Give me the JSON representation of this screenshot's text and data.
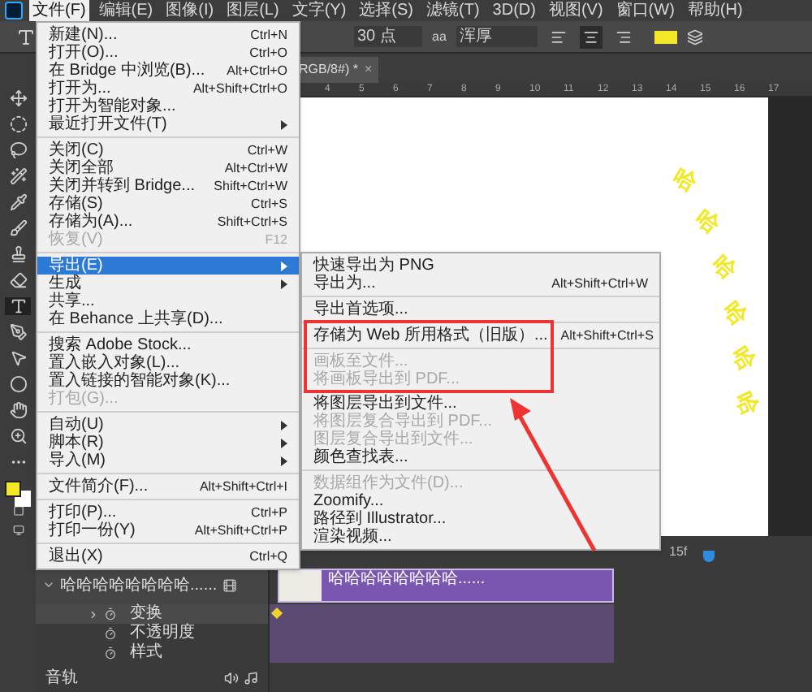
{
  "menubar": {
    "items": [
      {
        "label": "文件(F)",
        "selected": true
      },
      {
        "label": "编辑(E)",
        "selected": false
      },
      {
        "label": "图像(I)",
        "selected": false
      },
      {
        "label": "图层(L)",
        "selected": false
      },
      {
        "label": "文字(Y)",
        "selected": false
      },
      {
        "label": "选择(S)",
        "selected": false
      },
      {
        "label": "滤镜(T)",
        "selected": false
      },
      {
        "label": "3D(D)",
        "selected": false
      },
      {
        "label": "视图(V)",
        "selected": false
      },
      {
        "label": "窗口(W)",
        "selected": false
      },
      {
        "label": "帮助(H)",
        "selected": false
      }
    ]
  },
  "options_bar": {
    "font_size": "30 点",
    "antialias_label": "aa",
    "antialias": "浑厚",
    "align": [
      {
        "selected": false
      },
      {
        "selected": true
      },
      {
        "selected": false
      }
    ]
  },
  "document_tab": {
    "title": "RGB/8#) *",
    "close": "×"
  },
  "ruler": [
    "4",
    "5",
    "6",
    "7",
    "8",
    "9",
    "10",
    "11",
    "12",
    "13",
    "14",
    "15",
    "16",
    "17"
  ],
  "canvas": {
    "glyphs": [
      "哈",
      "哈",
      "哈",
      "哈",
      "哈",
      "哈"
    ]
  },
  "file_menu": {
    "groups": [
      [
        {
          "label": "新建(N)...",
          "shortcut": "Ctrl+N",
          "has_submenu": false,
          "disabled": false,
          "selected": false
        },
        {
          "label": "打开(O)...",
          "shortcut": "Ctrl+O",
          "has_submenu": false,
          "disabled": false,
          "selected": false
        },
        {
          "label": "在 Bridge 中浏览(B)...",
          "shortcut": "Alt+Ctrl+O",
          "has_submenu": false,
          "disabled": false,
          "selected": false
        },
        {
          "label": "打开为...",
          "shortcut": "Alt+Shift+Ctrl+O",
          "has_submenu": false,
          "disabled": false,
          "selected": false
        },
        {
          "label": "打开为智能对象...",
          "has_submenu": false,
          "disabled": false,
          "selected": false
        },
        {
          "label": "最近打开文件(T)",
          "has_submenu": true,
          "disabled": false,
          "selected": false
        }
      ],
      [
        {
          "label": "关闭(C)",
          "shortcut": "Ctrl+W",
          "has_submenu": false,
          "disabled": false,
          "selected": false
        },
        {
          "label": "关闭全部",
          "shortcut": "Alt+Ctrl+W",
          "has_submenu": false,
          "disabled": false,
          "selected": false
        },
        {
          "label": "关闭并转到 Bridge...",
          "shortcut": "Shift+Ctrl+W",
          "has_submenu": false,
          "disabled": false,
          "selected": false
        },
        {
          "label": "存储(S)",
          "shortcut": "Ctrl+S",
          "has_submenu": false,
          "disabled": false,
          "selected": false
        },
        {
          "label": "存储为(A)...",
          "shortcut": "Shift+Ctrl+S",
          "has_submenu": false,
          "disabled": false,
          "selected": false
        },
        {
          "label": "恢复(V)",
          "shortcut": "F12",
          "has_submenu": false,
          "disabled": true,
          "selected": false
        }
      ],
      [
        {
          "label": "导出(E)",
          "has_submenu": true,
          "disabled": false,
          "selected": true
        },
        {
          "label": "生成",
          "has_submenu": true,
          "disabled": false,
          "selected": false
        },
        {
          "label": "共享...",
          "has_submenu": false,
          "disabled": false,
          "selected": false
        },
        {
          "label": "在 Behance 上共享(D)...",
          "has_submenu": false,
          "disabled": false,
          "selected": false
        }
      ],
      [
        {
          "label": "搜索 Adobe Stock...",
          "has_submenu": false,
          "disabled": false,
          "selected": false
        },
        {
          "label": "置入嵌入对象(L)...",
          "has_submenu": false,
          "disabled": false,
          "selected": false
        },
        {
          "label": "置入链接的智能对象(K)...",
          "has_submenu": false,
          "disabled": false,
          "selected": false
        },
        {
          "label": "打包(G)...",
          "has_submenu": false,
          "disabled": true,
          "selected": false
        }
      ],
      [
        {
          "label": "自动(U)",
          "has_submenu": true,
          "disabled": false,
          "selected": false
        },
        {
          "label": "脚本(R)",
          "has_submenu": true,
          "disabled": false,
          "selected": false
        },
        {
          "label": "导入(M)",
          "has_submenu": true,
          "disabled": false,
          "selected": false
        }
      ],
      [
        {
          "label": "文件简介(F)...",
          "shortcut": "Alt+Shift+Ctrl+I",
          "has_submenu": false,
          "disabled": false,
          "selected": false
        }
      ],
      [
        {
          "label": "打印(P)...",
          "shortcut": "Ctrl+P",
          "has_submenu": false,
          "disabled": false,
          "selected": false
        },
        {
          "label": "打印一份(Y)",
          "shortcut": "Alt+Shift+Ctrl+P",
          "has_submenu": false,
          "disabled": false,
          "selected": false
        }
      ],
      [
        {
          "label": "退出(X)",
          "shortcut": "Ctrl+Q",
          "has_submenu": false,
          "disabled": false,
          "selected": false
        }
      ]
    ]
  },
  "export_submenu": {
    "groups": [
      [
        {
          "label": "快速导出为 PNG",
          "disabled": false
        },
        {
          "label": "导出为...",
          "shortcut": "Alt+Shift+Ctrl+W",
          "disabled": false
        }
      ],
      [
        {
          "label": "导出首选项...",
          "disabled": false
        }
      ],
      [
        {
          "label": "存储为 Web 所用格式（旧版）...",
          "shortcut": "Alt+Shift+Ctrl+S",
          "disabled": false
        }
      ],
      [
        {
          "label": "画板至文件...",
          "disabled": true
        },
        {
          "label": "将画板导出到 PDF...",
          "disabled": true
        },
        {
          "label": "将图层导出到文件...",
          "disabled": false
        },
        {
          "label": "将图层复合导出到 PDF...",
          "disabled": true
        },
        {
          "label": "图层复合导出到文件...",
          "disabled": true
        },
        {
          "label": "颜色查找表...",
          "disabled": false
        }
      ],
      [
        {
          "label": "数据组作为文件(D)...",
          "disabled": true
        },
        {
          "label": "Zoomify...",
          "disabled": false
        },
        {
          "label": "路径到 Illustrator...",
          "disabled": false
        },
        {
          "label": "渲染视频...",
          "disabled": false
        }
      ]
    ]
  },
  "timeline": {
    "frame_label": "15f",
    "layer_name": "哈哈哈哈哈哈哈哈......",
    "clip_label": "哈哈哈哈哈哈哈哈......",
    "properties": [
      "变换",
      "不透明度",
      "样式"
    ],
    "audio_track": "音轨"
  }
}
